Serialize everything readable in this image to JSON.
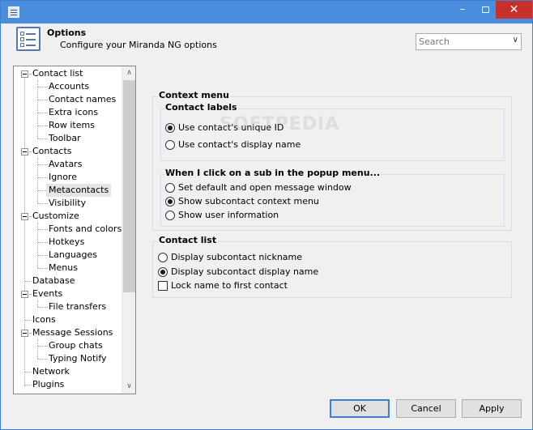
{
  "header": {
    "title": "Options",
    "subtitle": "Configure your Miranda NG options"
  },
  "search": {
    "placeholder": "Search"
  },
  "tree": {
    "items": [
      {
        "label": "Contact list"
      },
      {
        "label": "Accounts"
      },
      {
        "label": "Contact names"
      },
      {
        "label": "Extra icons"
      },
      {
        "label": "Row items"
      },
      {
        "label": "Toolbar"
      },
      {
        "label": "Contacts"
      },
      {
        "label": "Avatars"
      },
      {
        "label": "Ignore"
      },
      {
        "label": "Metacontacts"
      },
      {
        "label": "Visibility"
      },
      {
        "label": "Customize"
      },
      {
        "label": "Fonts and colors"
      },
      {
        "label": "Hotkeys"
      },
      {
        "label": "Languages"
      },
      {
        "label": "Menus"
      },
      {
        "label": "Database"
      },
      {
        "label": "Events"
      },
      {
        "label": "File transfers"
      },
      {
        "label": "Icons"
      },
      {
        "label": "Message Sessions"
      },
      {
        "label": "Group chats"
      },
      {
        "label": "Typing Notify"
      },
      {
        "label": "Network"
      },
      {
        "label": "Plugins"
      }
    ],
    "selected": "Metacontacts"
  },
  "context_menu": {
    "title": "Context menu",
    "contact_labels": {
      "title": "Contact labels",
      "options": [
        "Use contact's unique ID",
        "Use contact's display name"
      ],
      "selected": "Use contact's unique ID"
    },
    "popup": {
      "title": "When I click on a sub in the popup menu...",
      "options": [
        "Set default and open message window",
        "Show subcontact context menu",
        "Show user information"
      ],
      "selected": "Show subcontact context menu"
    }
  },
  "contact_list": {
    "title": "Contact list",
    "options": [
      "Display subcontact nickname",
      "Display subcontact display name"
    ],
    "selected": "Display subcontact display name",
    "lock_label": "Lock name to first contact",
    "lock_checked": false
  },
  "watermark": "SOFTPEDIA",
  "buttons": {
    "ok": "OK",
    "cancel": "Cancel",
    "apply": "Apply"
  }
}
